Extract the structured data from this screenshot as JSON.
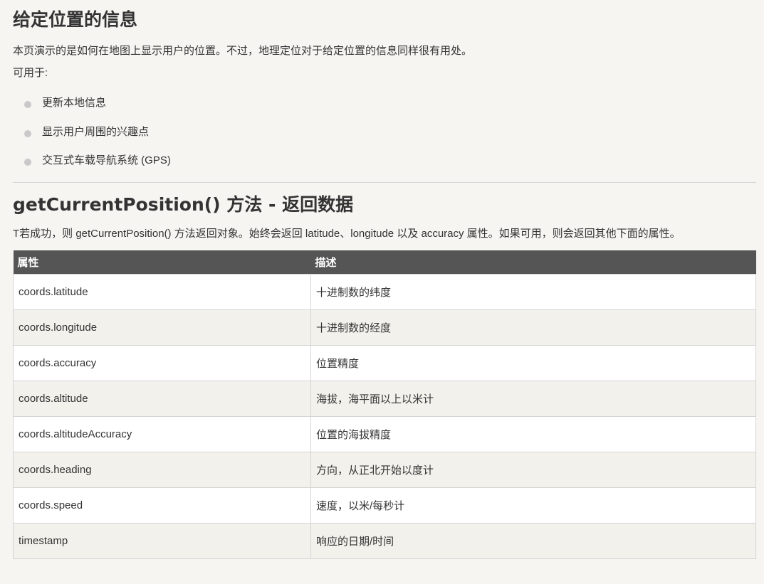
{
  "section1": {
    "title": "给定位置的信息",
    "intro": "本页演示的是如何在地图上显示用户的位置。不过，地理定位对于给定位置的信息同样很有用处。",
    "uses_label": "可用于:",
    "uses": [
      "更新本地信息",
      "显示用户周围的兴趣点",
      "交互式车载导航系统 (GPS)"
    ]
  },
  "section2": {
    "title": "getCurrentPosition() 方法 - 返回数据",
    "intro": "T若成功，则 getCurrentPosition() 方法返回对象。始终会返回 latitude、longitude 以及 accuracy 属性。如果可用，则会返回其他下面的属性。",
    "table": {
      "headers": [
        "属性",
        "描述"
      ],
      "rows": [
        [
          "coords.latitude",
          "十进制数的纬度"
        ],
        [
          "coords.longitude",
          "十进制数的经度"
        ],
        [
          "coords.accuracy",
          "位置精度"
        ],
        [
          "coords.altitude",
          "海拔，海平面以上以米计"
        ],
        [
          "coords.altitudeAccuracy",
          "位置的海拔精度"
        ],
        [
          "coords.heading",
          "方向，从正北开始以度计"
        ],
        [
          "coords.speed",
          "速度，以米/每秒计"
        ],
        [
          "timestamp",
          "响应的日期/时间"
        ]
      ]
    }
  }
}
